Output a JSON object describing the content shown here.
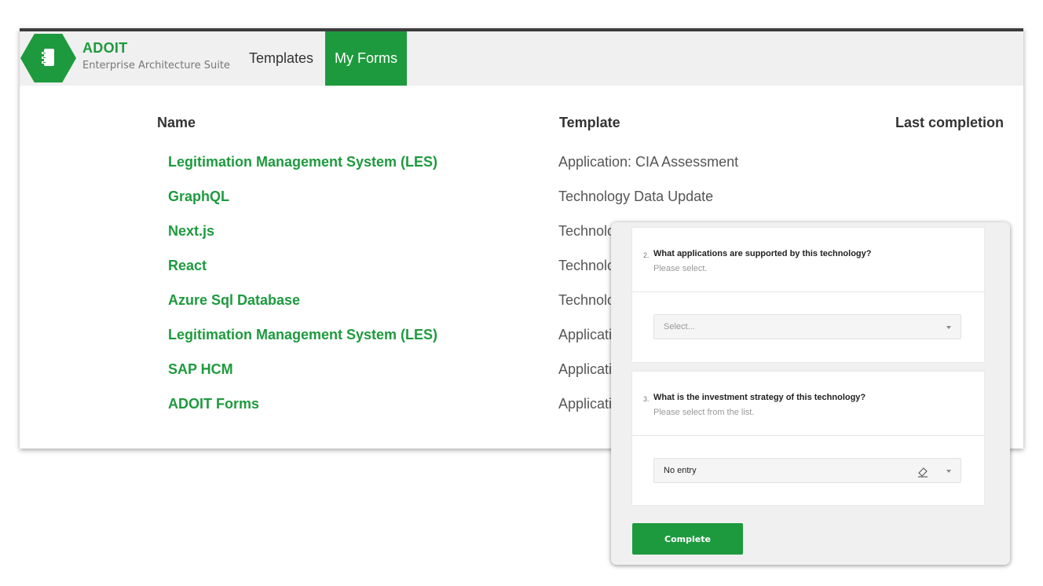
{
  "brand": {
    "title": "ADOIT",
    "subtitle": "Enterprise Architecture Suite",
    "logo_icon": "document-icon",
    "accent": "#1e9a3e"
  },
  "nav": {
    "tabs": [
      {
        "label": "Templates",
        "active": false
      },
      {
        "label": "My Forms",
        "active": true
      }
    ]
  },
  "table": {
    "columns": [
      "Name",
      "Template",
      "Last completion"
    ],
    "rows": [
      {
        "name": "Legitimation Management System (LES)",
        "template": "Application: CIA Assessment",
        "last_completion": ""
      },
      {
        "name": "GraphQL",
        "template": "Technology Data Update",
        "last_completion": ""
      },
      {
        "name": "Next.js",
        "template": "Technology Data Update",
        "last_completion": ""
      },
      {
        "name": "React",
        "template": "Technology Data Update",
        "last_completion": ""
      },
      {
        "name": "Azure Sql Database",
        "template": "Technology Data Update",
        "last_completion": ""
      },
      {
        "name": "Legitimation Management System (LES)",
        "template": "Application",
        "last_completion": ""
      },
      {
        "name": "SAP HCM",
        "template": "Application",
        "last_completion": ""
      },
      {
        "name": "ADOIT Forms",
        "template": "Application",
        "last_completion": ""
      }
    ]
  },
  "form": {
    "questions": [
      {
        "number": "2.",
        "text": "What applications are supported by this technology?",
        "hint": "Please select.",
        "select_placeholder": "Select...",
        "select_value": ""
      },
      {
        "number": "3.",
        "text": "What is the investment strategy of this technology?",
        "hint": "Please select from the list.",
        "select_placeholder": "",
        "select_value": "No entry"
      }
    ],
    "complete_label": "Complete"
  }
}
